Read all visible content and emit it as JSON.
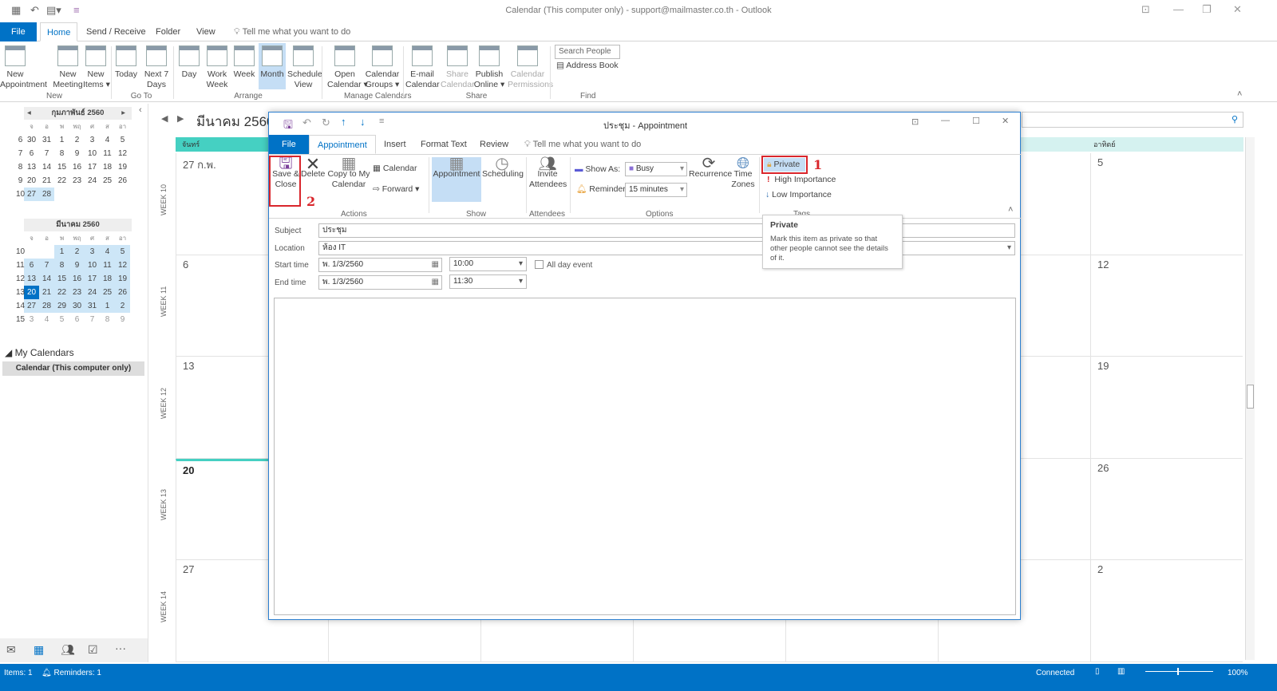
{
  "window": {
    "title": "Calendar (This computer only) - support@mailmaster.co.th - Outlook"
  },
  "tabs": [
    {
      "label": "File"
    },
    {
      "label": "Home"
    },
    {
      "label": "Send / Receive"
    },
    {
      "label": "Folder"
    },
    {
      "label": "View"
    }
  ],
  "tell_me": "Tell me what you want to do",
  "ribbon": {
    "new": {
      "label": "New",
      "buttons": [
        "New\nAppointment",
        "New\nMeeting",
        "New\nItems ▾"
      ]
    },
    "goto": {
      "label": "Go To",
      "buttons": [
        "Today",
        "Next 7\nDays"
      ]
    },
    "arrange": {
      "label": "Arrange",
      "buttons": [
        "Day",
        "Work\nWeek",
        "Week",
        "Month",
        "Schedule\nView"
      ],
      "selected": "Month"
    },
    "manage": {
      "label": "Manage Calendars",
      "buttons": [
        "Open\nCalendar ▾",
        "Calendar\nGroups ▾"
      ]
    },
    "share": {
      "label": "Share",
      "buttons": [
        "E-mail\nCalendar",
        "Share\nCalendar",
        "Publish\nOnline ▾",
        "Calendar\nPermissions"
      ]
    },
    "find": {
      "label": "Find",
      "search_placeholder": "Search People",
      "address_book": "Address Book"
    }
  },
  "nav": {
    "feb": {
      "title": "กุมภาพันธ์ 2560",
      "dow": [
        "จ",
        "อ",
        "พ",
        "พฤ",
        "ศ",
        "ส",
        "อา"
      ],
      "weeks": [
        "6",
        "7",
        "8",
        "9",
        "10"
      ],
      "rows": [
        [
          "30",
          "31",
          "1",
          "2",
          "3",
          "4",
          "5"
        ],
        [
          "6",
          "7",
          "8",
          "9",
          "10",
          "11",
          "12"
        ],
        [
          "13",
          "14",
          "15",
          "16",
          "17",
          "18",
          "19"
        ],
        [
          "20",
          "21",
          "22",
          "23",
          "24",
          "25",
          "26"
        ],
        [
          "27",
          "28",
          "",
          "",
          "",
          "",
          ""
        ]
      ]
    },
    "mar": {
      "title": "มีนาคม 2560",
      "dow": [
        "จ",
        "อ",
        "พ",
        "พฤ",
        "ศ",
        "ส",
        "อา"
      ],
      "weeks": [
        "10",
        "11",
        "12",
        "13",
        "14",
        "15"
      ],
      "rows": [
        [
          "",
          "",
          "1",
          "2",
          "3",
          "4",
          "5"
        ],
        [
          "6",
          "7",
          "8",
          "9",
          "10",
          "11",
          "12"
        ],
        [
          "13",
          "14",
          "15",
          "16",
          "17",
          "18",
          "19"
        ],
        [
          "20",
          "21",
          "22",
          "23",
          "24",
          "25",
          "26"
        ],
        [
          "27",
          "28",
          "29",
          "30",
          "31",
          "1",
          "2"
        ],
        [
          "3",
          "4",
          "5",
          "6",
          "7",
          "8",
          "9"
        ]
      ],
      "today": "20"
    },
    "my_calendars": "My Calendars",
    "calendar_item": "Calendar (This computer only)"
  },
  "main": {
    "month_title": "มีนาคม 2560",
    "day_headers": {
      "first": "จันทร์",
      "last": "อาทิตย์"
    },
    "weeks": [
      {
        "label": "WEEK 10",
        "first": "27 ก.พ.",
        "last": "5"
      },
      {
        "label": "WEEK 11",
        "first": "6",
        "last": "12"
      },
      {
        "label": "WEEK 12",
        "first": "13",
        "last": "19"
      },
      {
        "label": "WEEK 13",
        "first": "20",
        "last": "26"
      },
      {
        "label": "WEEK 14",
        "first": "27",
        "last": "2"
      }
    ]
  },
  "dialog": {
    "title": "ประชุม  -  Appointment",
    "tabs": [
      "File",
      "Appointment",
      "Insert",
      "Format Text",
      "Review"
    ],
    "tell_me": "Tell me what you want to do",
    "actions": {
      "label": "Actions",
      "save_close": "Save &\nClose",
      "delete": "Delete",
      "copy": "Copy to My\nCalendar",
      "calendar": "Calendar",
      "forward": "Forward"
    },
    "show": {
      "label": "Show",
      "appointment": "Appointment",
      "scheduling": "Scheduling"
    },
    "attendees": {
      "label": "Attendees",
      "invite": "Invite\nAttendees"
    },
    "options": {
      "label": "Options",
      "show_as_label": "Show As:",
      "show_as": "Busy",
      "reminder_label": "Reminder:",
      "reminder": "15 minutes",
      "recurrence": "Recurrence",
      "time_zones": "Time\nZones"
    },
    "tags": {
      "label": "Tags",
      "private": "Private",
      "high": "High Importance",
      "low": "Low Importance"
    },
    "fields": {
      "subject_label": "Subject",
      "subject": "ประชุม",
      "location_label": "Location",
      "location": "ห้อง IT",
      "start_label": "Start time",
      "start_date": "พ. 1/3/2560",
      "start_time": "10:00",
      "end_label": "End time",
      "end_date": "พ. 1/3/2560",
      "end_time": "11:30",
      "all_day": "All day event"
    },
    "tooltip": {
      "title": "Private",
      "body": "Mark this item as private so that other people cannot see the details of it."
    },
    "annotations": [
      "1",
      "2"
    ]
  },
  "status": {
    "items": "Items: 1",
    "reminders": "Reminders: 1",
    "connected": "Connected",
    "zoom": "100%"
  },
  "colors": {
    "accent": "#0072c6",
    "annotation": "#d9262c",
    "header_teal": "#45d0c2"
  }
}
